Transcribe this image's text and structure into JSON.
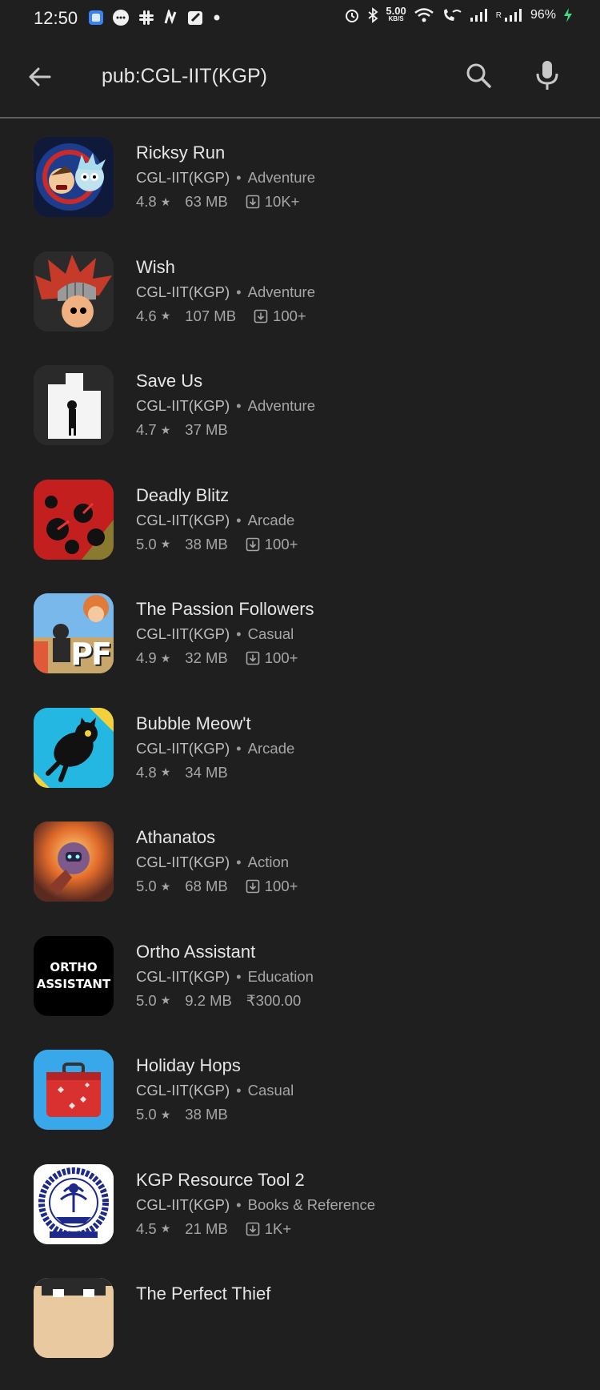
{
  "status_bar": {
    "time": "12:50",
    "net_speed_value": "5.00",
    "net_speed_unit": "KB/S",
    "roaming_label": "R",
    "battery": "96%"
  },
  "search": {
    "query": "pub:CGL-IIT(KGP)"
  },
  "apps": [
    {
      "name": "Ricksy Run",
      "developer": "CGL-IIT(KGP)",
      "category": "Adventure",
      "rating": "4.8",
      "size": "63 MB",
      "downloads": "10K+",
      "icon": "ricksy-run-icon"
    },
    {
      "name": "Wish",
      "developer": "CGL-IIT(KGP)",
      "category": "Adventure",
      "rating": "4.6",
      "size": "107 MB",
      "downloads": "100+",
      "icon": "wish-icon"
    },
    {
      "name": "Save Us",
      "developer": "CGL-IIT(KGP)",
      "category": "Adventure",
      "rating": "4.7",
      "size": "37 MB",
      "icon": "save-us-icon"
    },
    {
      "name": "Deadly Blitz",
      "developer": "CGL-IIT(KGP)",
      "category": "Arcade",
      "rating": "5.0",
      "size": "38 MB",
      "downloads": "100+",
      "icon": "deadly-blitz-icon"
    },
    {
      "name": "The Passion Followers",
      "developer": "CGL-IIT(KGP)",
      "category": "Casual",
      "rating": "4.9",
      "size": "32 MB",
      "downloads": "100+",
      "icon": "passion-followers-icon",
      "icon_text": "PF"
    },
    {
      "name": "Bubble Meow't",
      "developer": "CGL-IIT(KGP)",
      "category": "Arcade",
      "rating": "4.8",
      "size": "34 MB",
      "icon": "bubble-meowt-icon"
    },
    {
      "name": "Athanatos",
      "developer": "CGL-IIT(KGP)",
      "category": "Action",
      "rating": "5.0",
      "size": "68 MB",
      "downloads": "100+",
      "icon": "athanatos-icon"
    },
    {
      "name": "Ortho Assistant",
      "developer": "CGL-IIT(KGP)",
      "category": "Education",
      "rating": "5.0",
      "size": "9.2 MB",
      "price": "₹300.00",
      "icon": "ortho-assistant-icon",
      "icon_text_1": "ORTHO",
      "icon_text_2": "ASSISTANT"
    },
    {
      "name": "Holiday Hops",
      "developer": "CGL-IIT(KGP)",
      "category": "Casual",
      "rating": "5.0",
      "size": "38 MB",
      "icon": "holiday-hops-icon"
    },
    {
      "name": "KGP Resource Tool 2",
      "developer": "CGL-IIT(KGP)",
      "category": "Books & Reference",
      "rating": "4.5",
      "size": "21 MB",
      "downloads": "1K+",
      "icon": "kgp-resource-tool-icon"
    },
    {
      "name": "The Perfect Thief",
      "icon": "perfect-thief-icon"
    }
  ],
  "colors": {
    "background": "#1f1f1f",
    "divider": "#5f5f5f",
    "charging": "#3ddc84"
  }
}
